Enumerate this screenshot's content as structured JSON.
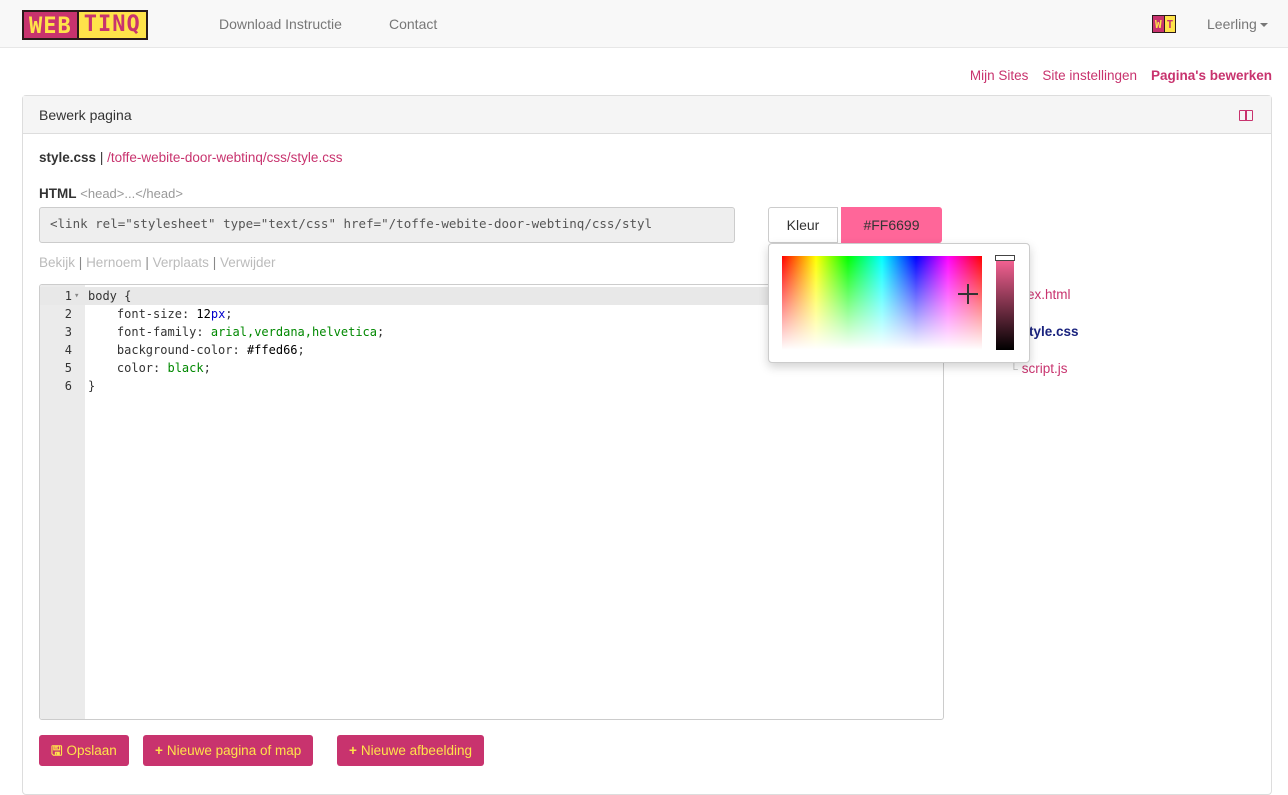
{
  "navbar": {
    "logo_part1": "WEB",
    "logo_part2": "TINQ",
    "links": [
      "Download Instructie",
      "Contact"
    ],
    "user_icon_part1": "W",
    "user_icon_part2": "T",
    "user_label": "Leerling"
  },
  "subnav": {
    "items": [
      "Mijn Sites",
      "Site instellingen",
      "Pagina's bewerken"
    ],
    "active_index": 2
  },
  "panel": {
    "title": "Bewerk pagina",
    "file_name": "style.css",
    "file_separator": "|",
    "file_path": "/toffe-webite-door-webtinq/css/style.css",
    "html_label": "HTML",
    "html_hint": "<head>...</head>",
    "head_value": "<link rel=\"stylesheet\" type=\"text/css\" href=\"/toffe-webite-door-webtinq/css/styl",
    "kleur_label": "Kleur",
    "color_value": "#FF6699",
    "actions": [
      "Bekijk",
      "Hernoem",
      "Verplaats",
      "Verwijder"
    ],
    "action_separator": "|"
  },
  "editor": {
    "lines": [
      {
        "n": "1",
        "fold": "▾",
        "text": "body {"
      },
      {
        "n": "2",
        "prop": "font-size",
        "value_num": "12",
        "value_unit": "px"
      },
      {
        "n": "3",
        "prop": "font-family",
        "value": "arial,verdana,helvetica"
      },
      {
        "n": "4",
        "prop": "background-color",
        "value_hex": "#ffed66"
      },
      {
        "n": "5",
        "prop": "color",
        "value": "black"
      },
      {
        "n": "6",
        "text": "}"
      }
    ]
  },
  "tree": {
    "items": [
      {
        "label": "ex.html",
        "current": false
      },
      {
        "label": "tyle.css",
        "current": true
      },
      {
        "label": "script.js",
        "current": false,
        "prefix": "└"
      }
    ]
  },
  "buttons": {
    "save": "Opslaan",
    "new_page": "Nieuwe pagina of map",
    "new_image": "Nieuwe afbeelding"
  },
  "colors": {
    "brand": "#c8336e",
    "brand_text": "#ffe34a",
    "picked": "#ff6699"
  }
}
